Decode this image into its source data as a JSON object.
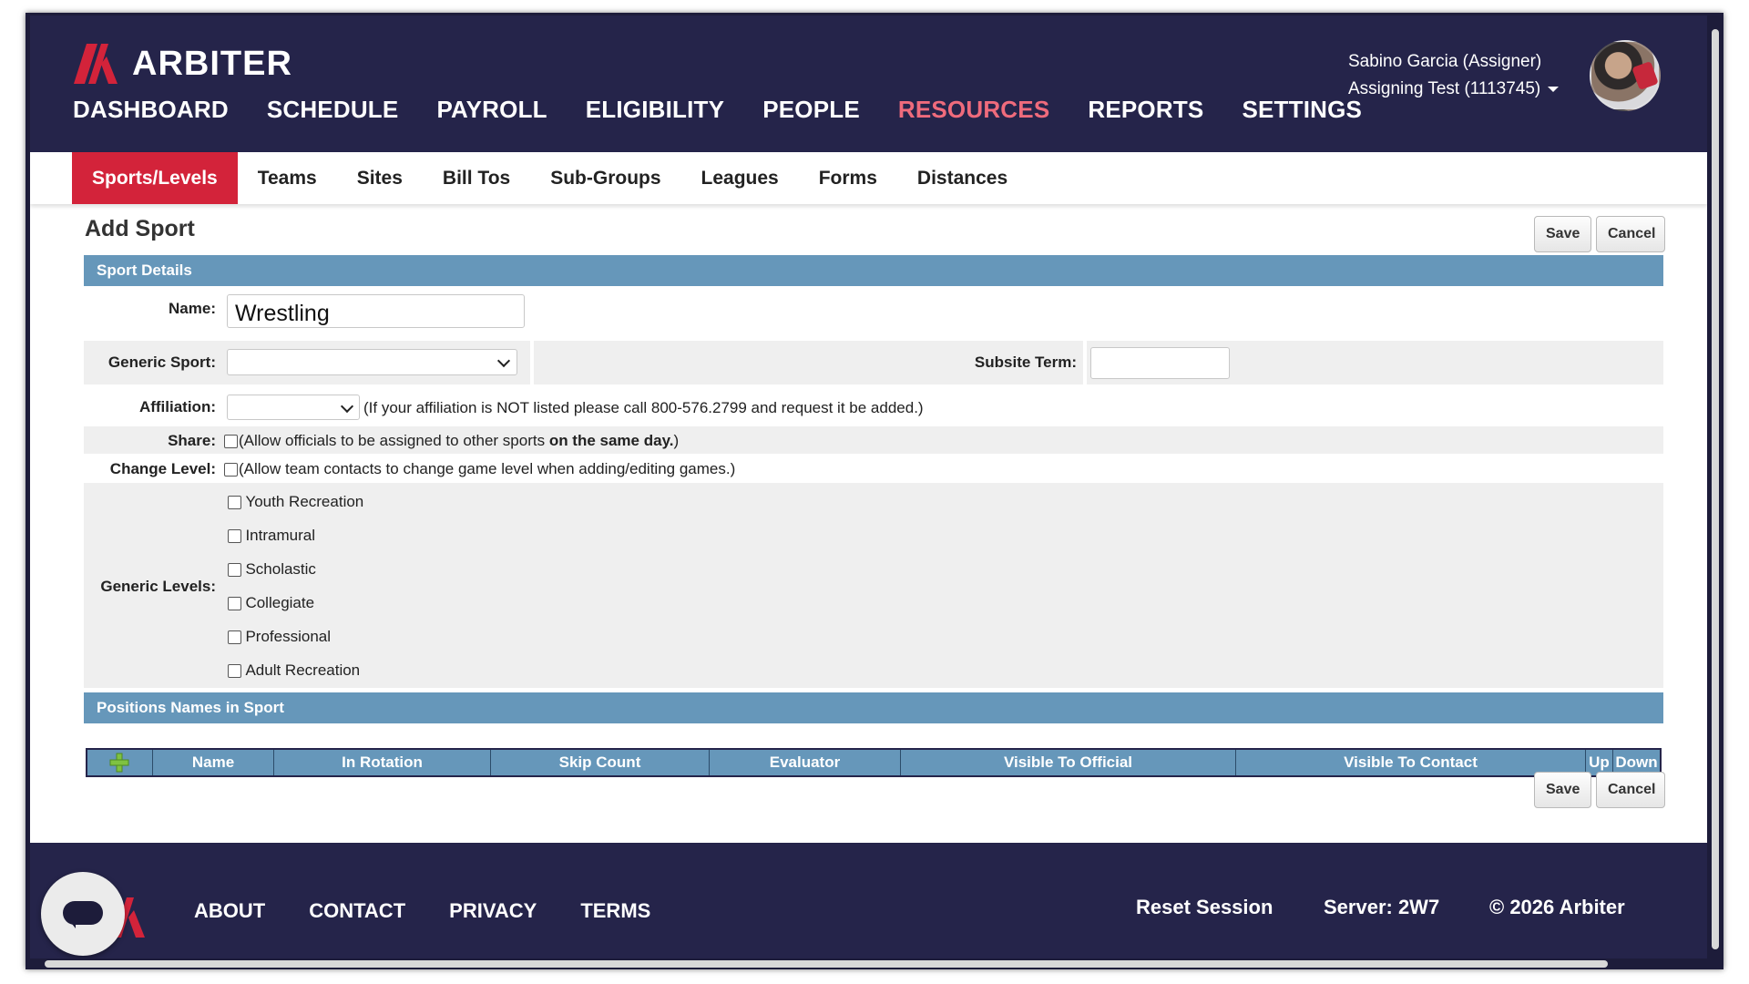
{
  "brand": {
    "name": "ARBITER",
    "accent": "#d3233a",
    "navy": "#25244a"
  },
  "main_nav": [
    {
      "label": "DASHBOARD",
      "active": false
    },
    {
      "label": "SCHEDULE",
      "active": false
    },
    {
      "label": "PAYROLL",
      "active": false
    },
    {
      "label": "ELIGIBILITY",
      "active": false
    },
    {
      "label": "PEOPLE",
      "active": false
    },
    {
      "label": "RESOURCES",
      "active": true
    },
    {
      "label": "REPORTS",
      "active": false
    },
    {
      "label": "SETTINGS",
      "active": false
    }
  ],
  "user": {
    "name": "Sabino Garcia (Assigner)",
    "account": "Assigning Test (1113745)"
  },
  "sub_nav": [
    {
      "label": "Sports/Levels",
      "active": true
    },
    {
      "label": "Teams"
    },
    {
      "label": "Sites"
    },
    {
      "label": "Bill Tos"
    },
    {
      "label": "Sub-Groups"
    },
    {
      "label": "Leagues"
    },
    {
      "label": "Forms"
    },
    {
      "label": "Distances"
    }
  ],
  "page": {
    "title": "Add Sport",
    "save_label": "Save",
    "cancel_label": "Cancel"
  },
  "sport_details": {
    "section_title": "Sport Details",
    "name_label": "Name:",
    "name_value": "Wrestling",
    "generic_sport_label": "Generic Sport:",
    "generic_sport_value": "",
    "subsite_term_label": "Subsite Term:",
    "subsite_term_value": "",
    "affiliation_label": "Affiliation:",
    "affiliation_value": "",
    "affiliation_note": "(If your affiliation is NOT listed please call 800-576.2799 and request it be added.)",
    "share_label": "Share:",
    "share_note_pre": "(Allow officials to be assigned to other sports ",
    "share_note_bold": "on the same day.",
    "share_note_post": ")",
    "change_level_label": "Change Level:",
    "change_level_note": "(Allow team contacts to change game level when adding/editing games.)",
    "generic_levels_label": "Generic Levels:",
    "generic_levels": [
      "Youth Recreation",
      "Intramural",
      "Scholastic",
      "Collegiate",
      "Professional",
      "Adult Recreation"
    ]
  },
  "positions": {
    "section_title": "Positions Names in Sport",
    "columns": [
      "Name",
      "In Rotation",
      "Skip Count",
      "Evaluator",
      "Visible To Official",
      "Visible To Contact",
      "Up",
      "Down"
    ]
  },
  "footer": {
    "links": [
      "ABOUT",
      "CONTACT",
      "PRIVACY",
      "TERMS"
    ],
    "reset_session": "Reset Session",
    "server": "Server: 2W7",
    "copyright": "© 2026 Arbiter"
  }
}
